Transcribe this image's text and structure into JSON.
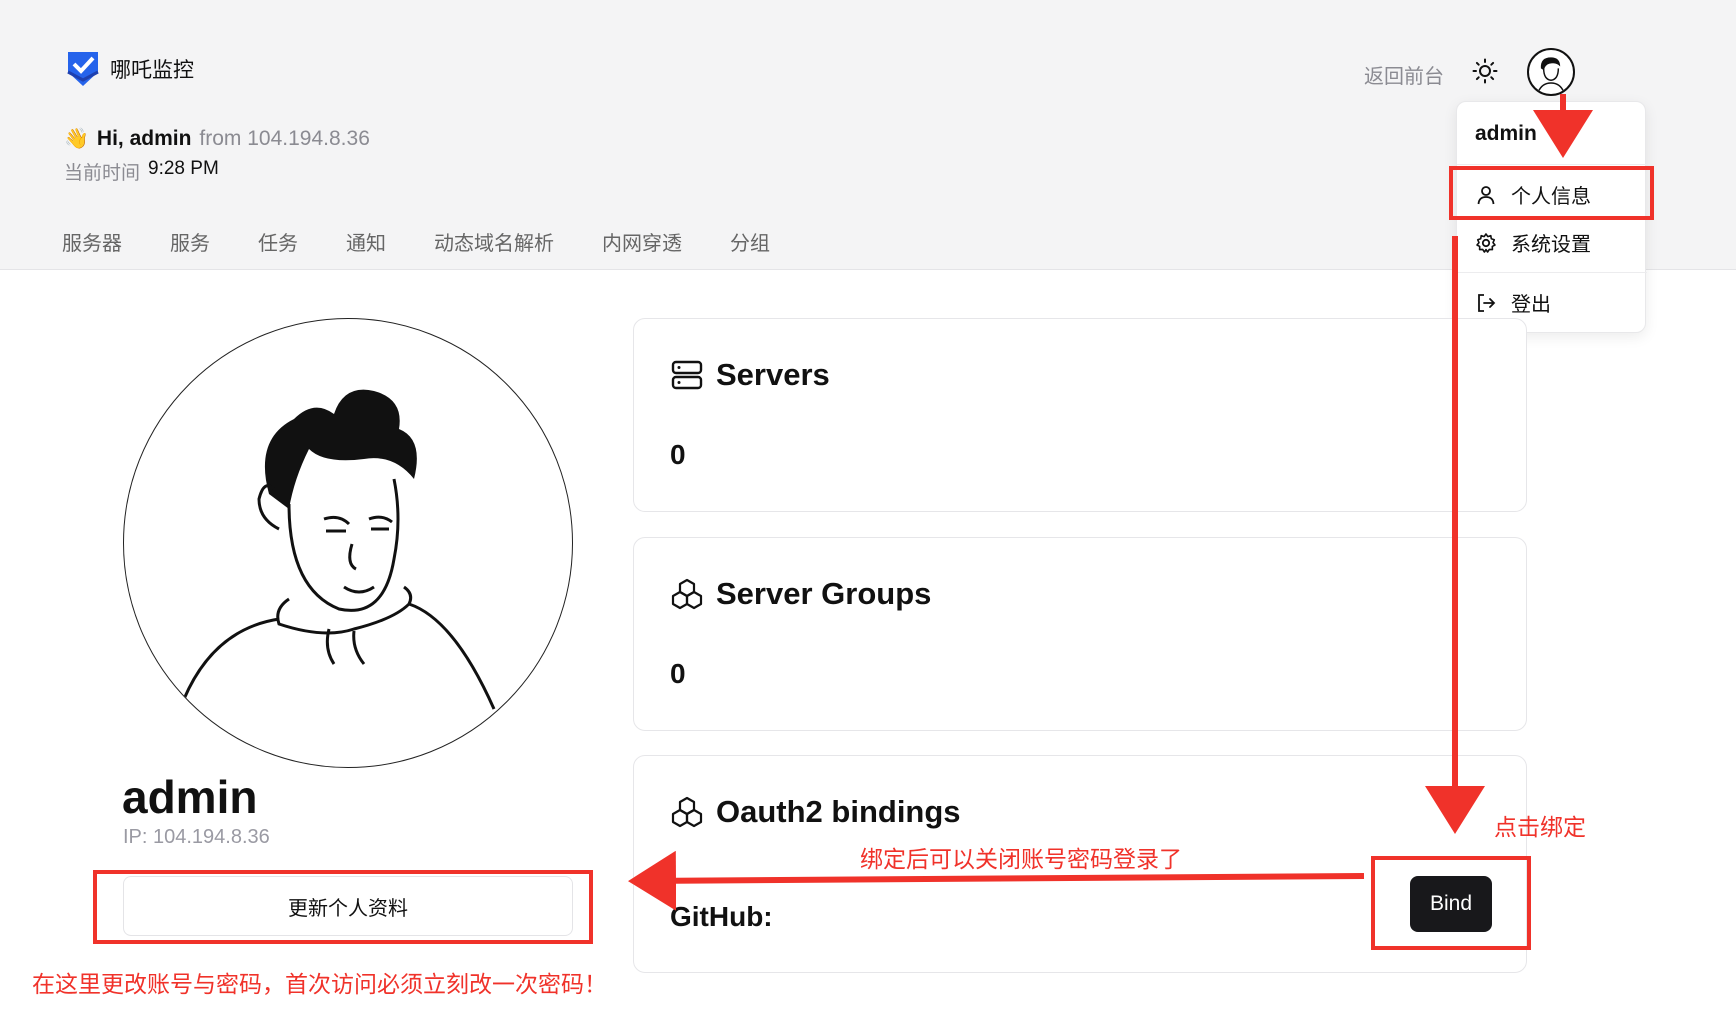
{
  "app": {
    "logo_text": "哪吒监控"
  },
  "greeting": {
    "hi": "Hi, admin",
    "from": "from 104.194.8.36",
    "time_label": "当前时间",
    "time_value": "9:28 PM"
  },
  "tabs": [
    "服务器",
    "服务",
    "任务",
    "通知",
    "动态域名解析",
    "内网穿透",
    "分组"
  ],
  "top_right": {
    "back_label": "返回前台"
  },
  "dropdown": {
    "username": "admin",
    "items": [
      {
        "label": "个人信息",
        "icon": "user-icon"
      },
      {
        "label": "系统设置",
        "icon": "gear-icon"
      },
      {
        "label": "登出",
        "icon": "logout-icon"
      }
    ]
  },
  "profile": {
    "name": "admin",
    "ip": "IP: 104.194.8.36",
    "update_button": "更新个人资料"
  },
  "cards": {
    "servers": {
      "title": "Servers",
      "value": "0"
    },
    "server_groups": {
      "title": "Server Groups",
      "value": "0"
    },
    "oauth": {
      "title": "Oauth2 bindings",
      "github_label": "GitHub:",
      "bind_button": "Bind"
    }
  },
  "annotations": {
    "click_bind": "点击绑定",
    "after_bind": "绑定后可以关闭账号密码登录了",
    "change_password": "在这里更改账号与密码，首次访问必须立刻改一次密码！",
    "color": "#f0322a"
  }
}
